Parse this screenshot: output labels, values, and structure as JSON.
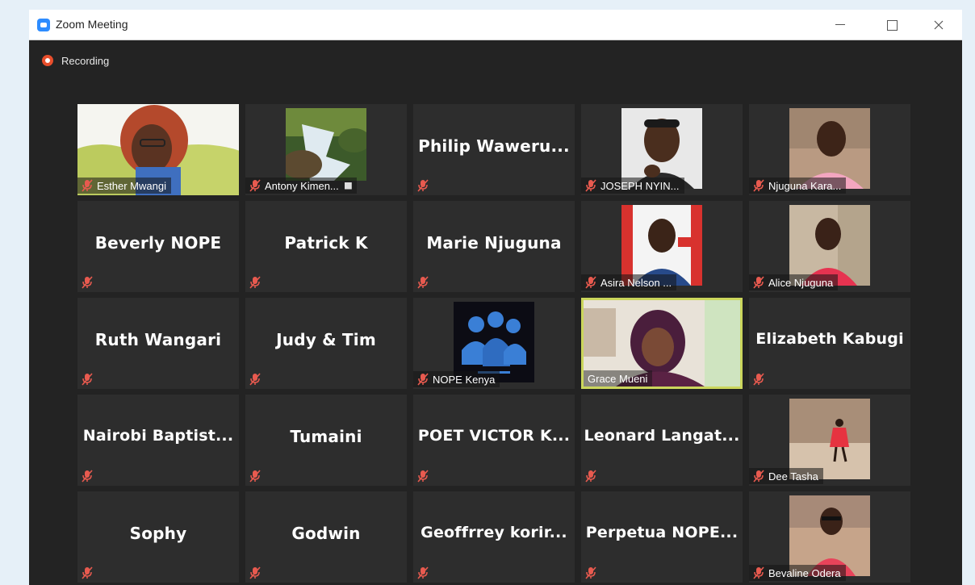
{
  "window": {
    "title": "Zoom Meeting"
  },
  "recording": {
    "label": "Recording"
  },
  "tiles": [
    {
      "name": "Esther Mwangi"
    },
    {
      "name": "Antony Kimen..."
    },
    {
      "name": "Philip  Waweru..."
    },
    {
      "name": "JOSEPH NYIN..."
    },
    {
      "name": "Njuguna Kara..."
    },
    {
      "name": "Beverly NOPE"
    },
    {
      "name": "Patrick K"
    },
    {
      "name": "Marie Njuguna"
    },
    {
      "name": "Asira Nelson ..."
    },
    {
      "name": "Alice Njuguna"
    },
    {
      "name": "Ruth Wangari"
    },
    {
      "name": "Judy & Tim"
    },
    {
      "name": "NOPE Kenya"
    },
    {
      "name": "Grace Mueni"
    },
    {
      "name": "Elizabeth Kabugi"
    },
    {
      "name": "Nairobi  Baptist..."
    },
    {
      "name": "Tumaini"
    },
    {
      "name": "POET  VICTOR  K..."
    },
    {
      "name": "Leonard  Langat..."
    },
    {
      "name": "Dee Tasha"
    },
    {
      "name": "Sophy"
    },
    {
      "name": "Godwin"
    },
    {
      "name": "Geoffrrey  korir..."
    },
    {
      "name": "Perpetua  NOPE..."
    },
    {
      "name": "Bevaline Odera"
    }
  ],
  "colors": {
    "background": "#232323",
    "tile": "#2d2d2d",
    "active_speaker_border": "#cbd65c",
    "muted_mic": "#e85a4f",
    "recording_dot": "#e84e2c"
  }
}
